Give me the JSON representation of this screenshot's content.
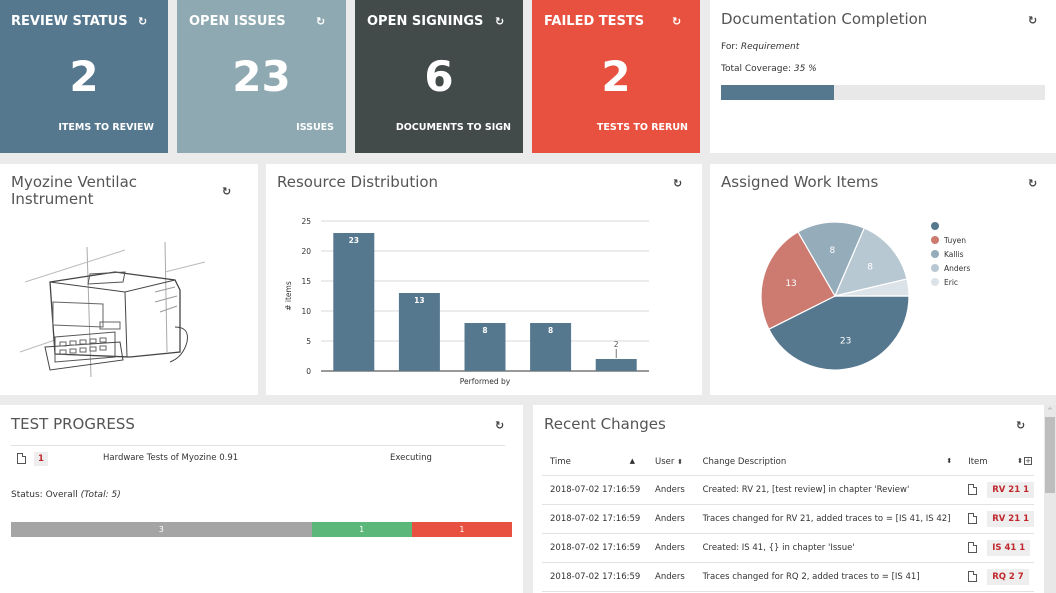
{
  "kpi_cards": [
    {
      "title": "REVIEW STATUS",
      "value": "2",
      "subtitle": "ITEMS TO REVIEW",
      "color": "#56788f"
    },
    {
      "title": "OPEN ISSUES",
      "value": "23",
      "subtitle": "ISSUES",
      "color": "#8ea9b1"
    },
    {
      "title": "OPEN SIGNINGS",
      "value": "6",
      "subtitle": "DOCUMENTS TO SIGN",
      "color": "#434a4a"
    },
    {
      "title": "FAILED TESTS",
      "value": "2",
      "subtitle": "TESTS TO RERUN",
      "color": "#e8503f"
    }
  ],
  "refresh_icon": "↻",
  "documentation": {
    "title": "Documentation Completion",
    "for_label": "For:",
    "for_value": "Requirement",
    "coverage_label": "Total Coverage:",
    "coverage_value": "35 %",
    "coverage_fraction": 0.35,
    "bar_color": "#56788f"
  },
  "instrument": {
    "title_line1": "Myozine Ventilac",
    "title_line2": "Instrument"
  },
  "resource_distribution": {
    "title": "Resource Distribution"
  },
  "assigned_work_items": {
    "title": "Assigned Work Items"
  },
  "chart_data": [
    {
      "type": "bar",
      "title": "Resource Distribution",
      "xlabel": "Performed by",
      "ylabel": "# items",
      "categories": [
        "",
        "",
        "",
        "",
        ""
      ],
      "values": [
        23,
        13,
        8,
        8,
        2
      ],
      "ylim": [
        0,
        25
      ],
      "yticks": [
        0,
        5,
        10,
        15,
        20,
        25
      ],
      "grid": true,
      "color": "#56788f"
    },
    {
      "type": "pie",
      "title": "Assigned Work Items",
      "labels": [
        "",
        "Tuyen",
        "Kallis",
        "Anders",
        "Eric"
      ],
      "values": [
        23,
        13,
        8,
        8,
        2
      ],
      "colors": [
        "#56788f",
        "#cd7a70",
        "#95acbb",
        "#b8c8d2",
        "#dbe3e8"
      ],
      "legend": "right"
    }
  ],
  "test_progress": {
    "title": "TEST PROGRESS",
    "row": {
      "badge": "1",
      "name": "Hardware Tests of Myozine 0.91",
      "status": "Executing"
    },
    "status_label": "Status: Overall",
    "total_label": "(Total: 5)",
    "segments": [
      {
        "label": "3",
        "value": 3,
        "color": "#a5a5a5"
      },
      {
        "label": "1",
        "value": 1,
        "color": "#5cb87a"
      },
      {
        "label": "1",
        "value": 1,
        "color": "#e8503f"
      }
    ]
  },
  "recent_changes": {
    "title": "Recent Changes",
    "columns": [
      "Time",
      "User",
      "Change Description",
      "Item"
    ],
    "rows": [
      {
        "time": "2018-07-02 17:16:59",
        "user": "Anders",
        "desc": "Created: RV 21, [test review] in chapter 'Review'",
        "item": "RV 21 1"
      },
      {
        "time": "2018-07-02 17:16:59",
        "user": "Anders",
        "desc": "Traces changed for RV 21, added traces to = [IS 41, IS 42]",
        "item": "RV 21 1"
      },
      {
        "time": "2018-07-02 17:16:59",
        "user": "Anders",
        "desc": "Created: IS 41, {} in chapter 'Issue'",
        "item": "IS 41 1"
      },
      {
        "time": "2018-07-02 17:16:59",
        "user": "Anders",
        "desc": "Traces changed for RQ 2, added traces to = [IS 41]",
        "item": "RQ 2 7"
      }
    ]
  }
}
